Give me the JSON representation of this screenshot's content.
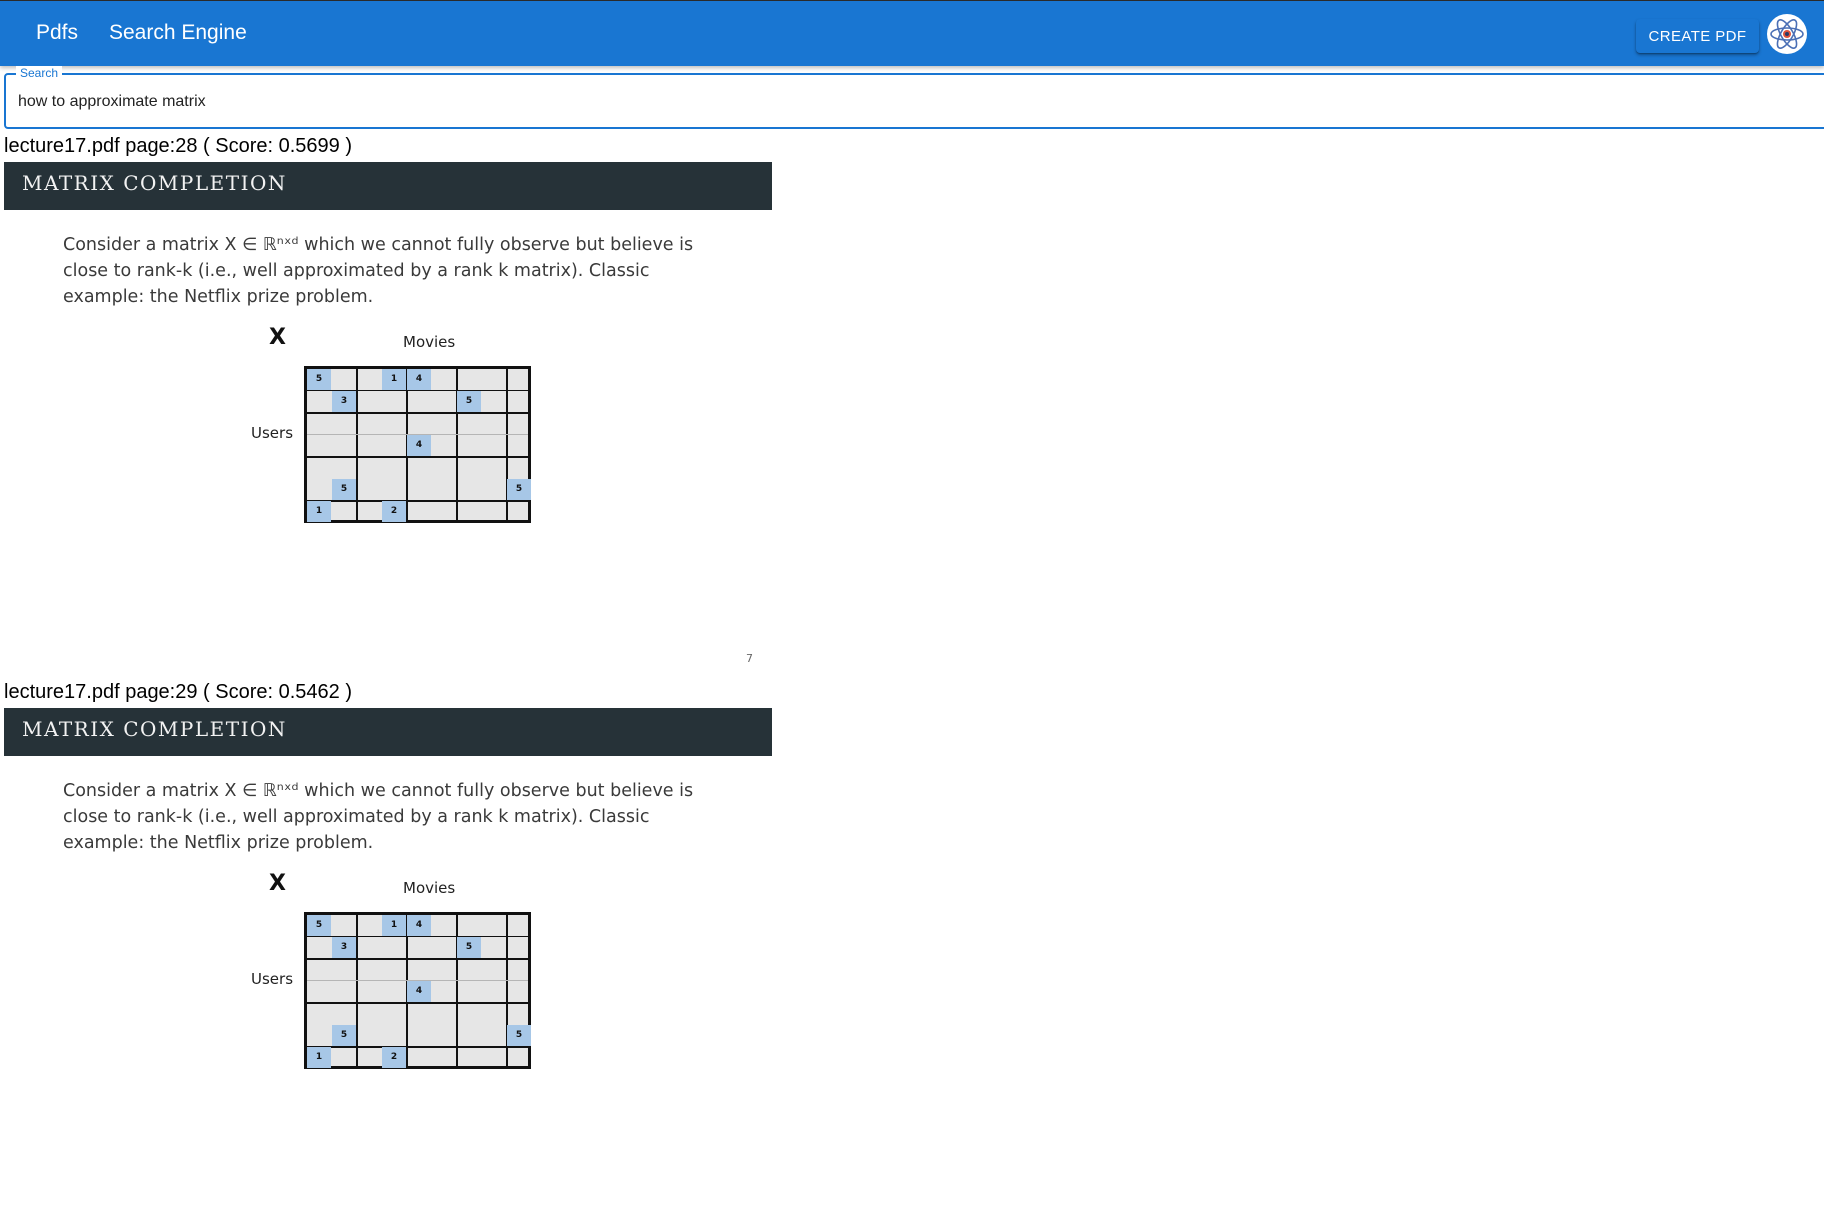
{
  "appbar": {
    "nav": [
      "Pdfs",
      "Search Engine"
    ],
    "create_label": "CREATE PDF",
    "color": "#1976d2"
  },
  "search": {
    "label": "Search",
    "value": "how to approximate matrix"
  },
  "results": [
    {
      "title": "lecture17.pdf page:28 ( Score: 0.5699 )",
      "slide": {
        "heading": "MATRIX COMPLETION",
        "lines": [
          "Consider a matrix X ∈ ℝⁿˣᵈ which we cannot fully observe but believe is",
          "close to rank-k (i.e., well approximated by a rank k matrix). Classic",
          "example: the Netflix prize problem."
        ],
        "matrix_label": "X",
        "col_label": "Movies",
        "row_label": "Users",
        "page_number": "7"
      }
    },
    {
      "title": "lecture17.pdf page:29 ( Score: 0.5462 )",
      "slide": {
        "heading": "MATRIX COMPLETION",
        "lines": [
          "Consider a matrix X ∈ ℝⁿˣᵈ which we cannot fully observe but believe is",
          "close to rank-k (i.e., well approximated by a rank k matrix). Classic",
          "example: the Netflix prize problem."
        ],
        "matrix_label": "X",
        "col_label": "Movies",
        "row_label": "Users",
        "page_number": ""
      }
    }
  ],
  "matrix_cells": [
    {
      "row": 0,
      "col": 0,
      "v": "5"
    },
    {
      "row": 0,
      "col": 3,
      "v": "1"
    },
    {
      "row": 0,
      "col": 4,
      "v": "4"
    },
    {
      "row": 1,
      "col": 1,
      "v": "3"
    },
    {
      "row": 1,
      "col": 6,
      "v": "5"
    },
    {
      "row": 3,
      "col": 4,
      "v": "4"
    },
    {
      "row": 5,
      "col": 1,
      "v": "5"
    },
    {
      "row": 5,
      "col": 8,
      "v": "5"
    },
    {
      "row": 6,
      "col": 0,
      "v": "1"
    },
    {
      "row": 6,
      "col": 3,
      "v": "2"
    }
  ]
}
